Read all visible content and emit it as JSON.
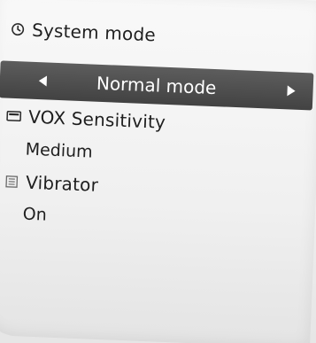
{
  "menu": {
    "system_mode": {
      "icon": "clock-icon",
      "label": "System mode",
      "selected_value": "Normal mode"
    },
    "vox_sensitivity": {
      "icon": "battery-icon",
      "label": "VOX Sensitivity",
      "value": "Medium"
    },
    "vibrator": {
      "icon": "vibrate-icon",
      "label": "Vibrator",
      "value": "On"
    }
  },
  "colors": {
    "highlight_bg": "#4a4a4a",
    "highlight_text": "#ffffff",
    "screen_bg": "#f2f2f2",
    "text": "#1f1f1f"
  }
}
